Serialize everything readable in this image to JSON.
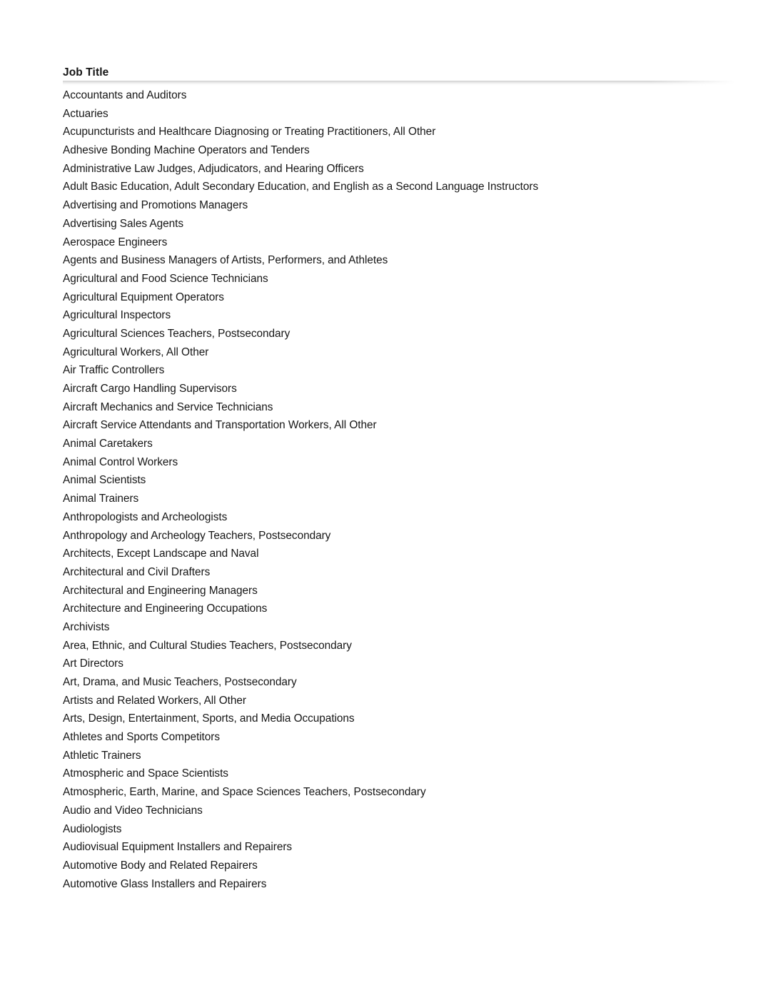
{
  "document": {
    "column_header": "Job Title",
    "rows": [
      "Accountants and Auditors",
      "Actuaries",
      "Acupuncturists and Healthcare Diagnosing or Treating Practitioners, All Other",
      "Adhesive Bonding Machine Operators and Tenders",
      "Administrative Law Judges, Adjudicators, and Hearing Officers",
      "Adult Basic Education, Adult Secondary Education, and English as a Second Language Instructors",
      "Advertising and Promotions Managers",
      "Advertising Sales Agents",
      "Aerospace Engineers",
      "Agents and Business Managers of Artists, Performers, and Athletes",
      "Agricultural and Food Science Technicians",
      "Agricultural Equipment Operators",
      "Agricultural Inspectors",
      "Agricultural Sciences Teachers, Postsecondary",
      "Agricultural Workers, All Other",
      "Air Traffic Controllers",
      "Aircraft Cargo Handling Supervisors",
      "Aircraft Mechanics and Service Technicians",
      "Aircraft Service Attendants and Transportation Workers, All Other",
      "Animal Caretakers",
      "Animal Control Workers",
      "Animal Scientists",
      "Animal Trainers",
      "Anthropologists and Archeologists",
      "Anthropology and Archeology Teachers, Postsecondary",
      "Architects, Except Landscape and Naval",
      "Architectural and Civil Drafters",
      "Architectural and Engineering Managers",
      "Architecture and Engineering Occupations",
      "Archivists",
      "Area, Ethnic, and Cultural Studies Teachers, Postsecondary",
      "Art Directors",
      "Art, Drama, and Music Teachers, Postsecondary",
      "Artists and Related Workers, All Other",
      "Arts, Design, Entertainment, Sports, and Media Occupations",
      "Athletes and Sports Competitors",
      "Athletic Trainers",
      "Atmospheric and Space Scientists",
      "Atmospheric, Earth, Marine, and Space Sciences Teachers, Postsecondary",
      "Audio and Video Technicians",
      "Audiologists",
      "Audiovisual Equipment Installers and Repairers",
      "Automotive Body and Related Repairers",
      "Automotive Glass Installers and Repairers"
    ],
    "colors": {
      "page_background": "#ffffff",
      "header_text": "#141414",
      "row_text": "#161616",
      "header_shadow": "#cdcdcd"
    }
  }
}
